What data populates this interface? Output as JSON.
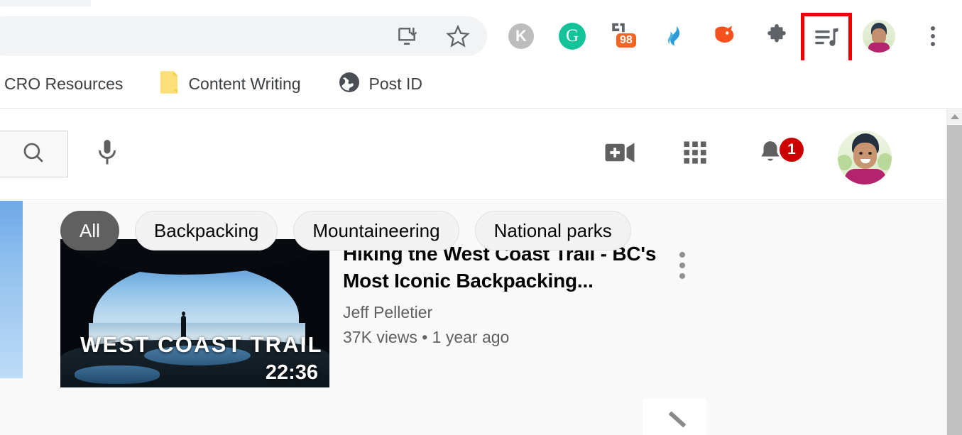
{
  "browser": {
    "omnibox": {
      "install_icon": "install-app-icon",
      "bookmark_icon": "bookmark-star-icon"
    },
    "extensions": [
      {
        "name": "kissmetrics-extension-icon",
        "glyph": "K",
        "color": "#bdbdbd",
        "badge": null
      },
      {
        "name": "grammarly-extension-icon",
        "glyph": "G",
        "color": "#15c39a",
        "badge": null
      },
      {
        "name": "seo-meta-extension-icon",
        "glyph": "",
        "color": "#5f6368",
        "badge": "98",
        "badge_color": "#f26522"
      },
      {
        "name": "flame-extension-icon",
        "glyph": "",
        "color": "#2d9bd8",
        "badge": null
      },
      {
        "name": "fox-seo-extension-icon",
        "glyph": "",
        "color": "#f4511e",
        "badge": null
      },
      {
        "name": "extensions-puzzle-icon",
        "glyph": "",
        "color": "#5f6368",
        "badge": null
      }
    ],
    "highlighted_extension": {
      "name": "playlist-music-extension-icon",
      "highlight_color": "#ee0000"
    },
    "profile_avatar": "chrome-profile-avatar",
    "menu_icon": "chrome-menu-icon"
  },
  "bookmarks": [
    {
      "label": "CRO Resources",
      "icon": "none"
    },
    {
      "label": "Content Writing",
      "icon": "yellow-note-icon"
    },
    {
      "label": "Post ID",
      "icon": "globe-icon"
    }
  ],
  "youtube": {
    "header": {
      "search_icon": "search-icon",
      "mic_icon": "microphone-icon",
      "create_icon": "create-video-icon",
      "apps_icon": "youtube-apps-grid-icon",
      "notifications_icon": "notifications-bell-icon",
      "notifications_count": "1",
      "avatar": "youtube-account-avatar"
    },
    "video": {
      "title": "Hiking the West Coast Trail - BC's Most Iconic Backpacking...",
      "channel": "Jeff Pelletier",
      "stats": "37K views • 1 year ago",
      "duration": "22:36",
      "thumbnail_text": "WEST COAST TRAIL",
      "menu_icon": "video-more-options-icon"
    },
    "chips": [
      {
        "label": "All",
        "active": true
      },
      {
        "label": "Backpacking",
        "active": false
      },
      {
        "label": "Mountaineering",
        "active": false
      },
      {
        "label": "National parks",
        "active": false
      }
    ],
    "scrollbar": {
      "up_arrow_icon": "scroll-up-arrow-icon"
    }
  },
  "colors": {
    "notification_red": "#cc0000",
    "highlight_red": "#ee0000",
    "badge_orange": "#f26522",
    "chip_active_bg": "#606060",
    "page_bg": "#f9f9f9"
  }
}
